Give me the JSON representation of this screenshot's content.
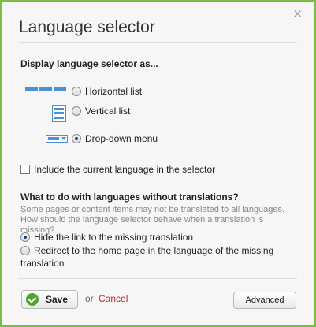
{
  "dialog": {
    "title": "Language selector",
    "close_glyph": "×"
  },
  "display": {
    "heading": "Display language selector as...",
    "options": [
      {
        "label": "Horizontal list",
        "icon": "horizontal-list-icon",
        "checked": false
      },
      {
        "label": "Vertical list",
        "icon": "vertical-list-icon",
        "checked": false
      },
      {
        "label": "Drop-down menu",
        "icon": "dropdown-menu-icon",
        "checked": true
      }
    ]
  },
  "include_current": {
    "label": "Include the current language in the selector",
    "checked": false
  },
  "missing": {
    "heading": "What to do with languages without translations?",
    "help": "Some pages or content items may not be translated to all languages. How should the language selector behave when a translation is missing?",
    "options": [
      {
        "label": "Hide the link to the missing translation",
        "checked": true
      },
      {
        "label_line1": "Redirect to the home page in the language of the missing",
        "label_line2": "translation",
        "checked": false
      }
    ]
  },
  "footer": {
    "save_label": "Save",
    "or_label": "or",
    "cancel_label": "Cancel",
    "advanced_label": "Advanced"
  },
  "colors": {
    "border": "#7dbb45",
    "icon_blue": "#4f8fd8",
    "cancel_red": "#c0272d",
    "save_green": "#4ea42d"
  }
}
